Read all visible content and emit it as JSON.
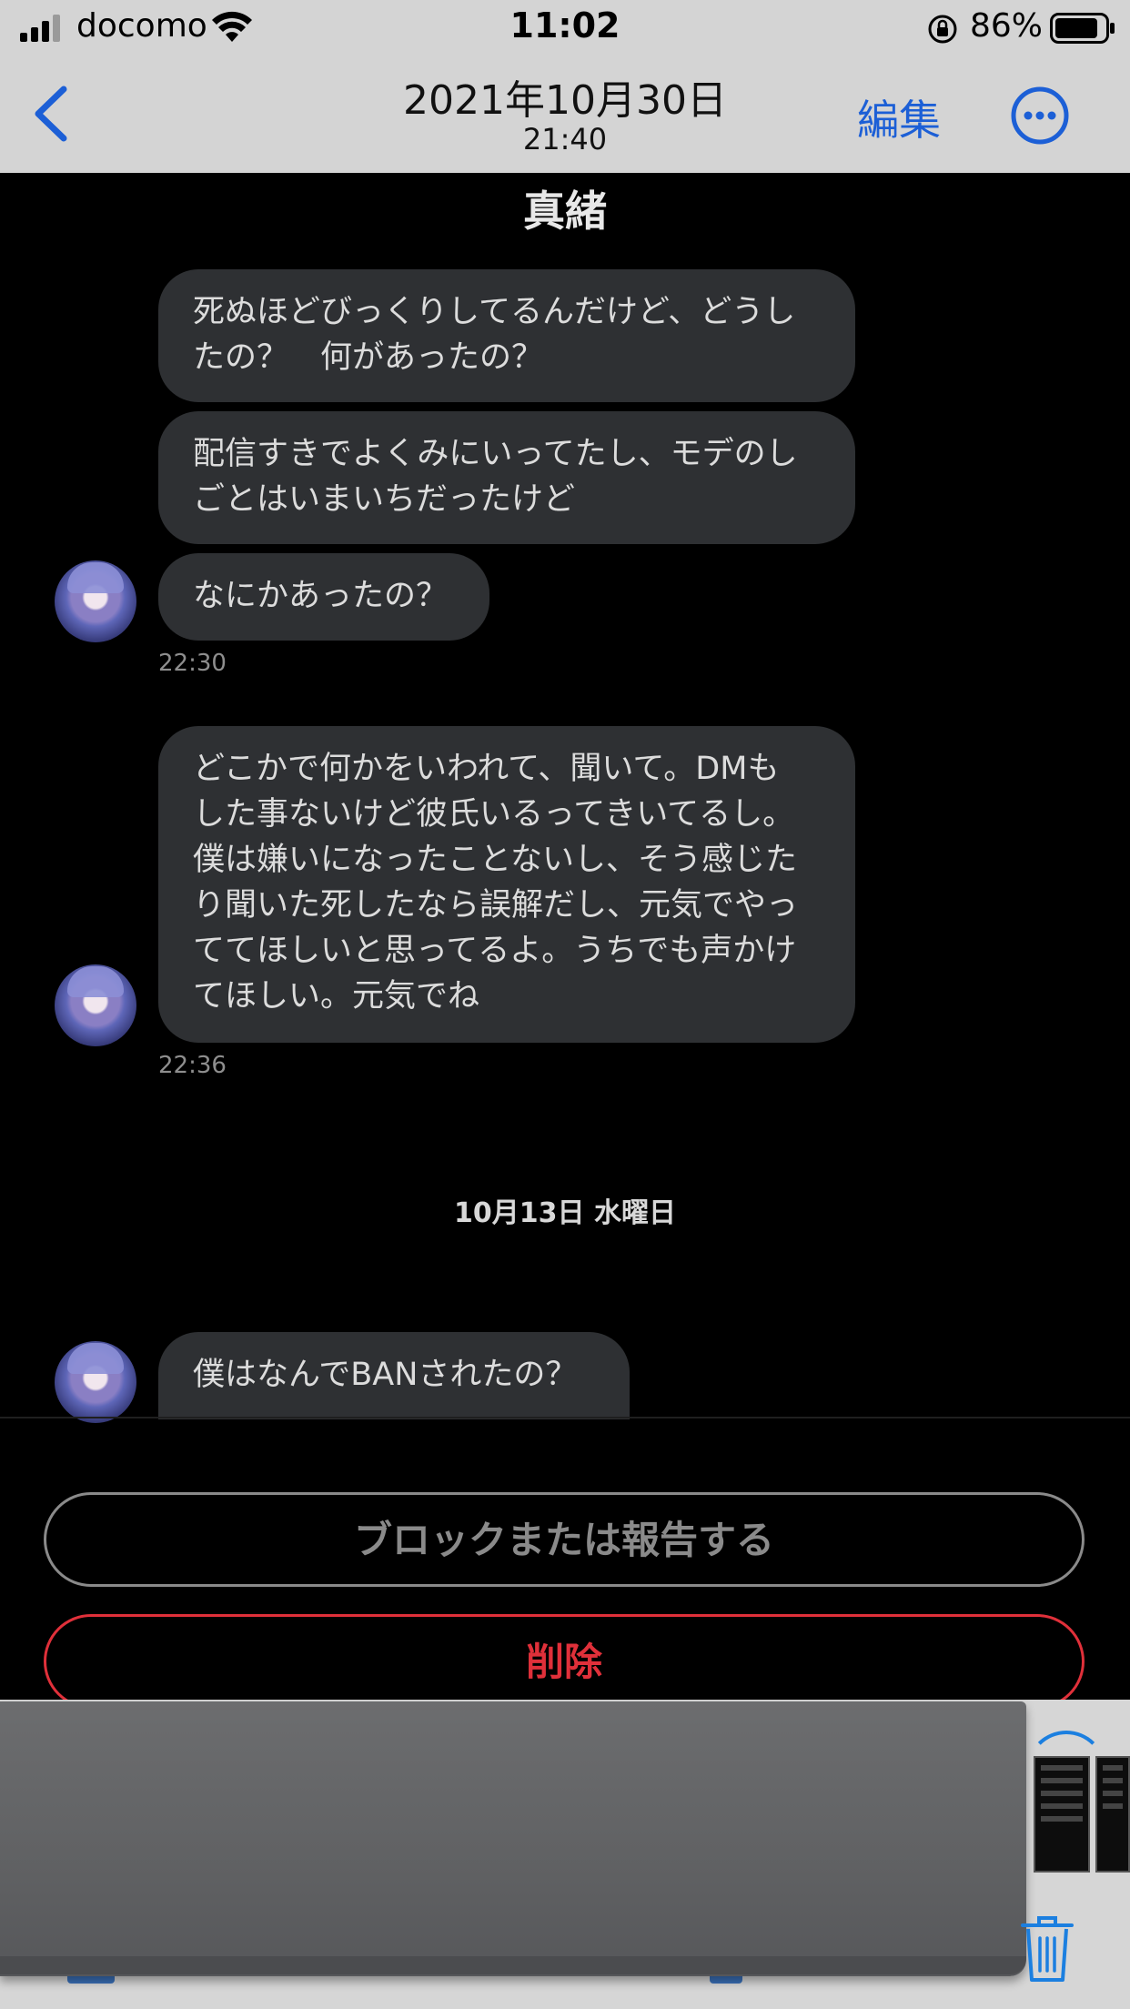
{
  "status_bar": {
    "carrier": "docomo",
    "time": "11:02",
    "battery_percent": "86%",
    "battery_level": 0.86
  },
  "nav": {
    "title": "2021年10月30日",
    "subtitle": "21:40",
    "edit_label": "編集"
  },
  "thread": {
    "sender_name": "真緒",
    "messages": [
      {
        "text": "死ぬほどびっくりしてるんだけど、どうし\nたの？　何があったの？"
      },
      {
        "text": "配信すきでよくみにいってたし、モデのし\nごとはいまいちだったけど"
      },
      {
        "text": "なにかあったの？"
      },
      {
        "text": "どこかで何かをいわれて、聞いて。DMも\nした事ないけど彼氏いるってきいてるし。\n僕は嫌いになったことないし、そう感じた\nり聞いた死したなら誤解だし、元気でやっ\nててほしいと思ってるよ。うちでも声かけ\nてほしい。元気でね"
      },
      {
        "text": "僕はなんでBANされたの？"
      }
    ],
    "timestamps": [
      "22:30",
      "22:36"
    ],
    "day_separator": "10月13日 水曜日"
  },
  "actions": {
    "block_label": "ブロックまたは報告する",
    "delete_label": "削除"
  },
  "colors": {
    "accent": "#1c5fd6",
    "danger": "#e0303a",
    "bubble": "#2e3033"
  }
}
